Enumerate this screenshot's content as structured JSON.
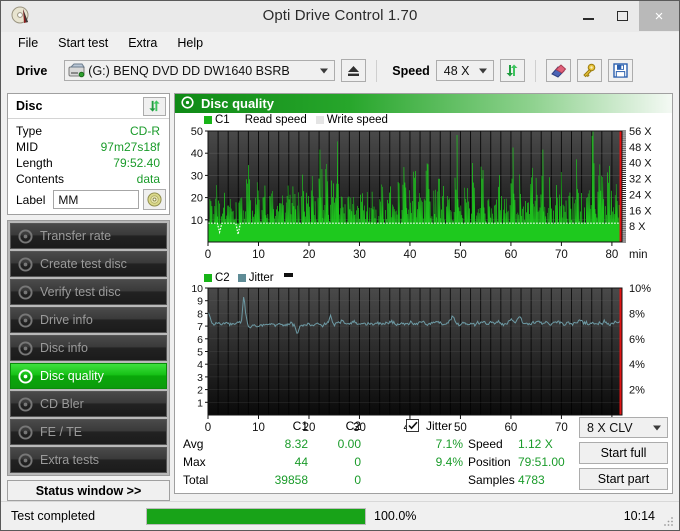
{
  "window": {
    "title": "Opti Drive Control 1.70",
    "icon": "disc-icon",
    "minimize": "minimize",
    "maximize": "maximize",
    "close": "×"
  },
  "menu": {
    "items": [
      {
        "label": "File",
        "name": "menu-file"
      },
      {
        "label": "Start test",
        "name": "menu-start-test"
      },
      {
        "label": "Extra",
        "name": "menu-extra"
      },
      {
        "label": "Help",
        "name": "menu-help"
      }
    ]
  },
  "toolbar": {
    "drive_label": "Drive",
    "drive_value": "(G:)   BENQ DVD DD DW1640 BSRB",
    "eject_icon": "eject-icon",
    "speed_label": "Speed",
    "speed_value": "48 X",
    "refresh_icon": "refresh-icon",
    "erase_icon": "eraser-icon",
    "key_icon": "key-icon",
    "save_icon": "save-icon"
  },
  "disc": {
    "title": "Disc",
    "refresh_icon": "refresh-icon",
    "rows": [
      {
        "key": "Type",
        "value": "CD-R"
      },
      {
        "key": "MID",
        "value": "97m27s18f"
      },
      {
        "key": "Length",
        "value": "79:52.40"
      },
      {
        "key": "Contents",
        "value": "data"
      }
    ],
    "label_key": "Label",
    "label_value": "MM",
    "label_button_icon": "cd-icon"
  },
  "nav": {
    "items": [
      {
        "label": "Transfer rate",
        "name": "sidebar-item-transfer-rate",
        "active": false
      },
      {
        "label": "Create test disc",
        "name": "sidebar-item-create-test-disc",
        "active": false
      },
      {
        "label": "Verify test disc",
        "name": "sidebar-item-verify-test-disc",
        "active": false
      },
      {
        "label": "Drive info",
        "name": "sidebar-item-drive-info",
        "active": false
      },
      {
        "label": "Disc info",
        "name": "sidebar-item-disc-info",
        "active": false
      },
      {
        "label": "Disc quality",
        "name": "sidebar-item-disc-quality",
        "active": true
      },
      {
        "label": "CD Bler",
        "name": "sidebar-item-cd-bler",
        "active": false
      },
      {
        "label": "FE / TE",
        "name": "sidebar-item-fe-te",
        "active": false
      },
      {
        "label": "Extra tests",
        "name": "sidebar-item-extra-tests",
        "active": false
      }
    ],
    "status_window": "Status window >>"
  },
  "panel": {
    "header_title": "Disc quality",
    "header_icon": "disc-quality-icon"
  },
  "stats": {
    "col_c1": "C1",
    "col_c2": "C2",
    "row_avg": "Avg",
    "row_max": "Max",
    "row_total": "Total",
    "avg_c1": "8.32",
    "avg_c2": "0.00",
    "max_c1": "44",
    "max_c2": "0",
    "total_c1": "39858",
    "total_c2": "0",
    "jitter_label": "Jitter",
    "jitter_checked": true,
    "jitter_avg": "7.1%",
    "jitter_max": "9.4%",
    "speed_label": "Speed",
    "speed_value": "1.12 X",
    "position_label": "Position",
    "position_value": "79:51.00",
    "samples_label": "Samples",
    "samples_value": "4783",
    "speed_select": "8 X CLV",
    "start_full": "Start full",
    "start_part": "Start part"
  },
  "statusbar": {
    "text": "Test completed",
    "progress_percent": "100.0%",
    "progress_value": 100,
    "elapsed": "10:14"
  },
  "chart_data": [
    {
      "type": "area",
      "name": "c1-chart",
      "title": "C1",
      "legend": [
        {
          "label": "C1",
          "color": "#17b417"
        },
        {
          "label": "Read speed",
          "color": "#ffffff"
        },
        {
          "label": "Write speed",
          "color": "#e8e8e8"
        }
      ],
      "xlabel": "min",
      "xlim": [
        0,
        82
      ],
      "xticks": [
        0,
        10,
        20,
        30,
        40,
        50,
        60,
        70,
        80
      ],
      "xticklabels": [
        "0",
        "10",
        "20",
        "30",
        "40",
        "50",
        "60",
        "70",
        "80"
      ],
      "ylim": [
        0,
        50
      ],
      "yticks": [
        10,
        20,
        30,
        40,
        50
      ],
      "yticklabels": [
        "10",
        "20",
        "30",
        "40",
        "50"
      ],
      "y2label": "X",
      "y2lim": [
        0,
        56
      ],
      "y2ticks": [
        8,
        16,
        24,
        32,
        40,
        48,
        56
      ],
      "y2ticklabels": [
        "8 X",
        "16 X",
        "24 X",
        "32 X",
        "40 X",
        "48 X",
        "56 X"
      ],
      "grid": true,
      "background": "#2b2b2b",
      "series": [
        {
          "name": "C1",
          "color": "#17b417",
          "values": [
            14,
            20,
            9,
            16,
            22,
            13,
            10,
            19,
            8,
            15,
            21,
            12,
            17,
            9,
            24,
            14,
            11,
            20,
            32,
            13,
            9,
            18,
            25,
            10,
            16,
            22,
            8,
            14,
            28,
            12,
            19,
            10,
            23,
            15,
            9,
            21,
            17,
            13,
            26,
            11,
            18,
            9,
            30,
            14,
            20,
            12,
            24,
            16,
            10,
            22,
            38,
            13,
            34,
            18,
            9,
            29,
            15,
            37,
            11,
            23,
            16,
            10,
            20,
            14,
            26,
            9,
            18,
            12,
            31,
            15,
            22,
            10,
            17,
            27,
            13,
            9,
            19,
            24,
            11,
            16,
            32,
            14,
            20,
            9,
            25,
            12,
            18,
            30,
            15,
            22,
            10,
            39,
            17,
            13,
            27,
            11,
            19,
            35,
            14,
            9,
            23,
            16,
            28,
            12,
            20,
            10,
            25,
            15,
            9,
            18,
            43,
            13,
            22,
            11,
            26,
            16,
            9,
            30,
            14,
            20,
            12,
            37,
            17,
            10,
            24,
            15,
            9,
            21,
            13,
            28,
            11,
            19,
            16,
            9,
            22,
            34,
            14,
            10,
            25,
            17,
            12,
            20,
            9,
            31,
            15,
            23,
            11,
            18,
            33,
            13,
            9,
            26,
            16,
            10,
            21,
            14,
            27,
            12,
            19,
            9,
            24,
            16,
            11,
            29,
            13,
            20,
            9,
            17,
            25,
            12,
            44,
            18,
            10,
            38,
            22,
            14,
            9,
            30,
            16,
            11,
            24,
            13,
            9,
            20
          ]
        },
        {
          "name": "Read speed",
          "color": "#ffffff",
          "values": [
            8,
            8,
            8,
            8,
            8,
            4,
            8,
            8,
            8,
            8,
            8,
            8,
            8,
            3,
            8,
            8,
            8,
            8,
            8,
            8,
            8,
            8,
            8,
            8,
            8,
            8,
            8,
            8,
            8,
            8,
            8,
            8,
            8,
            8,
            8,
            8,
            8,
            8,
            8,
            8,
            8,
            8,
            8,
            8,
            8,
            8,
            8,
            8,
            8,
            8,
            8,
            8,
            8,
            8,
            8,
            8,
            8,
            8,
            8,
            8,
            8,
            8,
            8,
            8,
            8,
            8,
            8,
            8,
            8,
            8,
            8,
            8,
            8,
            8,
            8,
            8,
            8,
            8,
            8,
            8,
            8,
            8,
            8,
            8,
            8,
            8,
            8,
            8,
            8,
            8,
            8,
            8,
            8,
            8,
            8,
            8,
            8,
            8,
            8,
            8,
            8,
            8,
            8,
            8,
            8,
            8,
            8,
            8,
            8,
            8,
            8,
            8,
            8,
            8,
            8,
            8,
            8,
            8,
            8,
            8,
            8,
            8,
            8,
            8,
            8,
            8,
            8,
            8,
            8,
            8,
            8,
            8,
            8,
            8,
            8,
            8,
            8,
            8,
            8,
            8,
            8,
            8,
            8,
            8,
            8,
            8,
            8,
            8,
            8,
            8,
            8,
            8,
            8,
            8,
            8,
            8,
            8,
            8,
            8,
            8,
            8,
            8,
            8,
            8,
            8,
            8,
            8,
            8,
            8,
            8,
            8,
            8,
            8,
            8,
            8,
            8,
            8,
            8,
            8,
            8
          ]
        }
      ]
    },
    {
      "type": "line",
      "name": "c2-jitter-chart",
      "title": "C2 / Jitter",
      "legend": [
        {
          "label": "C2",
          "color": "#17b417"
        },
        {
          "label": "Jitter",
          "color": "#5f8c96"
        }
      ],
      "xlabel": "min",
      "xlim": [
        0,
        82
      ],
      "xticks": [
        0,
        10,
        20,
        30,
        40,
        50,
        60,
        70,
        80
      ],
      "xticklabels": [
        "0",
        "10",
        "20",
        "30",
        "40",
        "50",
        "60",
        "70",
        "80"
      ],
      "ylim": [
        0,
        10
      ],
      "yticks": [
        1,
        2,
        3,
        4,
        5,
        6,
        7,
        8,
        9,
        10
      ],
      "yticklabels": [
        "1",
        "2",
        "3",
        "4",
        "5",
        "6",
        "7",
        "8",
        "9",
        "10"
      ],
      "y2lim": [
        0,
        10
      ],
      "y2ticks": [
        2,
        4,
        6,
        8,
        10
      ],
      "y2ticklabels": [
        "2%",
        "4%",
        "6%",
        "8%",
        "10%"
      ],
      "grid": true,
      "background": "#2b2b2b",
      "series": [
        {
          "name": "Jitter",
          "color": "#6d99a3",
          "values": [
            8.1,
            7.6,
            7.2,
            7.1,
            7.3,
            7.2,
            7.1,
            7.2,
            7.3,
            7.2,
            7.1,
            7.2,
            7.1,
            7.2,
            7.3,
            7.2,
            9.4,
            8.0,
            7.0,
            6.9,
            7.1,
            7.0,
            6.9,
            7.1,
            7.0,
            7.2,
            7.1,
            7.0,
            7.2,
            7.1,
            7.0,
            7.2,
            7.3,
            7.1,
            7.0,
            7.2,
            7.1,
            7.3,
            7.1,
            7.0,
            6.3,
            6.9,
            7.1,
            7.0,
            7.1,
            7.2,
            7.1,
            7.0,
            7.1,
            7.2,
            7.1,
            7.0,
            7.1,
            7.2,
            7.3,
            7.8,
            7.2,
            7.1,
            7.3,
            7.2,
            7.4,
            7.3,
            7.2,
            7.3,
            7.2,
            7.4,
            7.3,
            7.2,
            7.1,
            7.3,
            7.2,
            7.1,
            7.3,
            7.2,
            7.1,
            7.2,
            7.3,
            7.2,
            7.1,
            7.2,
            7.3,
            7.2,
            7.4,
            7.3,
            7.2,
            7.1,
            7.2,
            7.3,
            7.2,
            7.1,
            7.2,
            7.3,
            7.2,
            7.1,
            7.2,
            7.3,
            7.4,
            7.3,
            7.2,
            7.1,
            7.2,
            7.3,
            7.2,
            7.4,
            7.3,
            7.2,
            7.1,
            7.2,
            7.3,
            7.5,
            7.8,
            7.4,
            7.2,
            7.1,
            7.2,
            7.3,
            7.2,
            7.1,
            7.3,
            7.2,
            7.1,
            7.3,
            7.2,
            7.4,
            7.3,
            7.2,
            7.1,
            7.3,
            7.2,
            7.1,
            7.4,
            7.3,
            7.2,
            7.1,
            7.2,
            7.3,
            7.5,
            7.4,
            7.2,
            7.6,
            7.8,
            7.4,
            7.2,
            7.3,
            7.2,
            7.1,
            7.3,
            7.2,
            7.4,
            7.3,
            7.2,
            7.3,
            7.4,
            7.2,
            7.1,
            7.3,
            7.2,
            7.4,
            7.3,
            7.2,
            7.1,
            7.2,
            7.3,
            7.2,
            7.1,
            7.3,
            7.2,
            7.6,
            7.4,
            7.2,
            7.3,
            7.1,
            7.2,
            7.3,
            7.2,
            7.1,
            7.3,
            7.2,
            7.4,
            7.3,
            7.2,
            7.1,
            7.2,
            7.3,
            7.2,
            7.4,
            7.3
          ]
        },
        {
          "name": "C2",
          "color": "#17b417",
          "values": [
            0,
            0,
            0,
            0,
            0,
            0,
            0,
            0,
            0,
            0
          ]
        }
      ]
    }
  ]
}
